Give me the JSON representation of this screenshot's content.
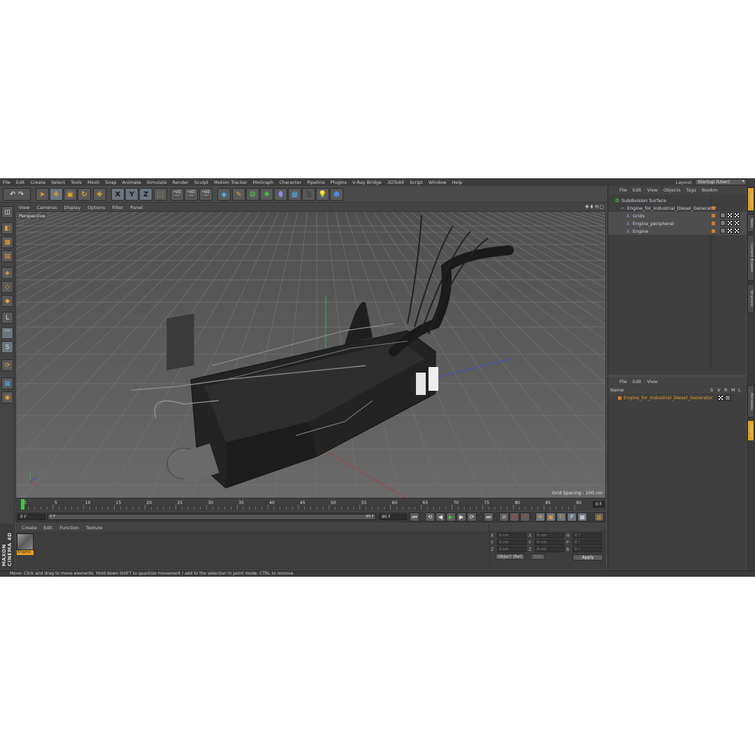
{
  "menubar": {
    "items": [
      "File",
      "Edit",
      "Create",
      "Select",
      "Tools",
      "Mesh",
      "Snap",
      "Animate",
      "Simulate",
      "Render",
      "Sculpt",
      "Motion Tracker",
      "MoGraph",
      "Character",
      "Pipeline",
      "Plugins",
      "V-Ray Bridge",
      "3DToAll",
      "Script",
      "Window",
      "Help"
    ],
    "layout_label": "Layout:",
    "layout_value": "Startup (User)"
  },
  "toolbar": {
    "x_label": "X",
    "y_label": "Y",
    "z_label": "Z"
  },
  "viewport": {
    "menu": [
      "View",
      "Cameras",
      "Display",
      "Options",
      "Filter",
      "Panel"
    ],
    "label": "Perspective",
    "grid_spacing": "Grid Spacing : 100 cm"
  },
  "timeline": {
    "ticks": [
      "0",
      "5",
      "10",
      "15",
      "20",
      "25",
      "30",
      "35",
      "40",
      "45",
      "50",
      "55",
      "60",
      "65",
      "70",
      "75",
      "80",
      "85",
      "90"
    ],
    "end_frame_box": "0 F",
    "current_frame": "0 F",
    "range_start": "0 F",
    "range_end_inner": "90 F",
    "range_end": "90 F"
  },
  "materials": {
    "menu": [
      "Create",
      "Edit",
      "Function",
      "Texture"
    ],
    "swatch_label": "Engine"
  },
  "coordinates": {
    "rows": [
      {
        "a": "X",
        "av": "0 cm",
        "b": "X",
        "bv": "0 cm",
        "c": "H",
        "cv": "0 °"
      },
      {
        "a": "Y",
        "av": "0 cm",
        "b": "Y",
        "bv": "0 cm",
        "c": "P",
        "cv": "0 °"
      },
      {
        "a": "Z",
        "av": "0 cm",
        "b": "Z",
        "bv": "0 cm",
        "c": "B",
        "cv": "0 °"
      }
    ],
    "mode": "Object (Rel)",
    "size": "Size",
    "apply": "Apply"
  },
  "objects": {
    "menu": [
      "File",
      "Edit",
      "View",
      "Objects",
      "Tags",
      "Bookm"
    ],
    "tree": [
      {
        "name": "Subdivision Surface",
        "indent": 0
      },
      {
        "name": "Engine_for_Industrial_Diesel_Generator",
        "indent": 1
      },
      {
        "name": "Grids",
        "indent": 2
      },
      {
        "name": "Engine_peripheral",
        "indent": 2
      },
      {
        "name": "Engine",
        "indent": 2
      }
    ]
  },
  "layers": {
    "menu": [
      "File",
      "Edit",
      "View"
    ],
    "columns": {
      "name": "Name",
      "s": "S",
      "v": "V",
      "r": "R",
      "m": "M",
      "l": "L"
    },
    "item": "Engine_for_Industrial_Diesel_Generator"
  },
  "right_tabs": [
    "Objects",
    "Takes",
    "Content Browser",
    "Structure"
  ],
  "right_tabs2": [
    "Attributes",
    "Layers"
  ],
  "logo": "MAXON CINEMA 4D",
  "status": "Move: Click and drag to move elements. Hold down SHIFT to quantize movement / add to the selection in point mode, CTRL to remove.",
  "colors": {
    "accent": "#e8a020",
    "bg": "#4a4a4a",
    "viewport": "#5e5e5e"
  }
}
